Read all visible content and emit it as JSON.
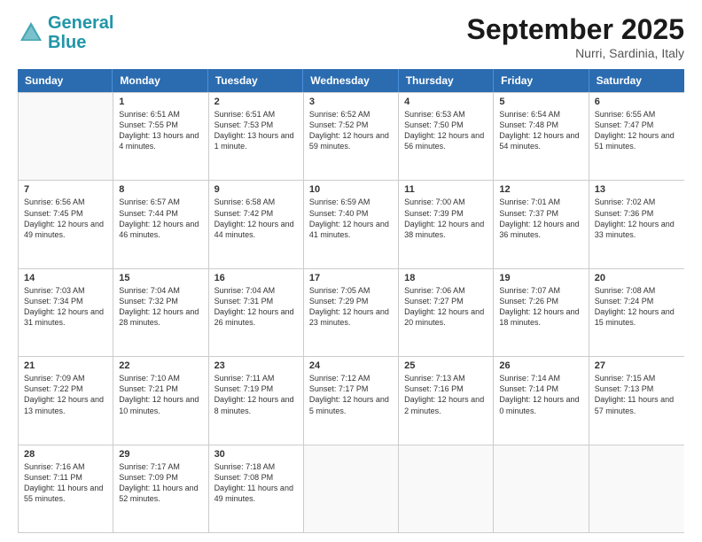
{
  "header": {
    "logo_general": "General",
    "logo_blue": "Blue",
    "month_title": "September 2025",
    "location": "Nurri, Sardinia, Italy"
  },
  "weekdays": [
    "Sunday",
    "Monday",
    "Tuesday",
    "Wednesday",
    "Thursday",
    "Friday",
    "Saturday"
  ],
  "rows": [
    [
      {
        "day": "",
        "empty": true
      },
      {
        "day": "1",
        "sunrise": "6:51 AM",
        "sunset": "7:55 PM",
        "daylight": "13 hours and 4 minutes."
      },
      {
        "day": "2",
        "sunrise": "6:51 AM",
        "sunset": "7:53 PM",
        "daylight": "13 hours and 1 minute."
      },
      {
        "day": "3",
        "sunrise": "6:52 AM",
        "sunset": "7:52 PM",
        "daylight": "12 hours and 59 minutes."
      },
      {
        "day": "4",
        "sunrise": "6:53 AM",
        "sunset": "7:50 PM",
        "daylight": "12 hours and 56 minutes."
      },
      {
        "day": "5",
        "sunrise": "6:54 AM",
        "sunset": "7:48 PM",
        "daylight": "12 hours and 54 minutes."
      },
      {
        "day": "6",
        "sunrise": "6:55 AM",
        "sunset": "7:47 PM",
        "daylight": "12 hours and 51 minutes."
      }
    ],
    [
      {
        "day": "7",
        "sunrise": "6:56 AM",
        "sunset": "7:45 PM",
        "daylight": "12 hours and 49 minutes."
      },
      {
        "day": "8",
        "sunrise": "6:57 AM",
        "sunset": "7:44 PM",
        "daylight": "12 hours and 46 minutes."
      },
      {
        "day": "9",
        "sunrise": "6:58 AM",
        "sunset": "7:42 PM",
        "daylight": "12 hours and 44 minutes."
      },
      {
        "day": "10",
        "sunrise": "6:59 AM",
        "sunset": "7:40 PM",
        "daylight": "12 hours and 41 minutes."
      },
      {
        "day": "11",
        "sunrise": "7:00 AM",
        "sunset": "7:39 PM",
        "daylight": "12 hours and 38 minutes."
      },
      {
        "day": "12",
        "sunrise": "7:01 AM",
        "sunset": "7:37 PM",
        "daylight": "12 hours and 36 minutes."
      },
      {
        "day": "13",
        "sunrise": "7:02 AM",
        "sunset": "7:36 PM",
        "daylight": "12 hours and 33 minutes."
      }
    ],
    [
      {
        "day": "14",
        "sunrise": "7:03 AM",
        "sunset": "7:34 PM",
        "daylight": "12 hours and 31 minutes."
      },
      {
        "day": "15",
        "sunrise": "7:04 AM",
        "sunset": "7:32 PM",
        "daylight": "12 hours and 28 minutes."
      },
      {
        "day": "16",
        "sunrise": "7:04 AM",
        "sunset": "7:31 PM",
        "daylight": "12 hours and 26 minutes."
      },
      {
        "day": "17",
        "sunrise": "7:05 AM",
        "sunset": "7:29 PM",
        "daylight": "12 hours and 23 minutes."
      },
      {
        "day": "18",
        "sunrise": "7:06 AM",
        "sunset": "7:27 PM",
        "daylight": "12 hours and 20 minutes."
      },
      {
        "day": "19",
        "sunrise": "7:07 AM",
        "sunset": "7:26 PM",
        "daylight": "12 hours and 18 minutes."
      },
      {
        "day": "20",
        "sunrise": "7:08 AM",
        "sunset": "7:24 PM",
        "daylight": "12 hours and 15 minutes."
      }
    ],
    [
      {
        "day": "21",
        "sunrise": "7:09 AM",
        "sunset": "7:22 PM",
        "daylight": "12 hours and 13 minutes."
      },
      {
        "day": "22",
        "sunrise": "7:10 AM",
        "sunset": "7:21 PM",
        "daylight": "12 hours and 10 minutes."
      },
      {
        "day": "23",
        "sunrise": "7:11 AM",
        "sunset": "7:19 PM",
        "daylight": "12 hours and 8 minutes."
      },
      {
        "day": "24",
        "sunrise": "7:12 AM",
        "sunset": "7:17 PM",
        "daylight": "12 hours and 5 minutes."
      },
      {
        "day": "25",
        "sunrise": "7:13 AM",
        "sunset": "7:16 PM",
        "daylight": "12 hours and 2 minutes."
      },
      {
        "day": "26",
        "sunrise": "7:14 AM",
        "sunset": "7:14 PM",
        "daylight": "12 hours and 0 minutes."
      },
      {
        "day": "27",
        "sunrise": "7:15 AM",
        "sunset": "7:13 PM",
        "daylight": "11 hours and 57 minutes."
      }
    ],
    [
      {
        "day": "28",
        "sunrise": "7:16 AM",
        "sunset": "7:11 PM",
        "daylight": "11 hours and 55 minutes."
      },
      {
        "day": "29",
        "sunrise": "7:17 AM",
        "sunset": "7:09 PM",
        "daylight": "11 hours and 52 minutes."
      },
      {
        "day": "30",
        "sunrise": "7:18 AM",
        "sunset": "7:08 PM",
        "daylight": "11 hours and 49 minutes."
      },
      {
        "day": "",
        "empty": true
      },
      {
        "day": "",
        "empty": true
      },
      {
        "day": "",
        "empty": true
      },
      {
        "day": "",
        "empty": true
      }
    ]
  ]
}
